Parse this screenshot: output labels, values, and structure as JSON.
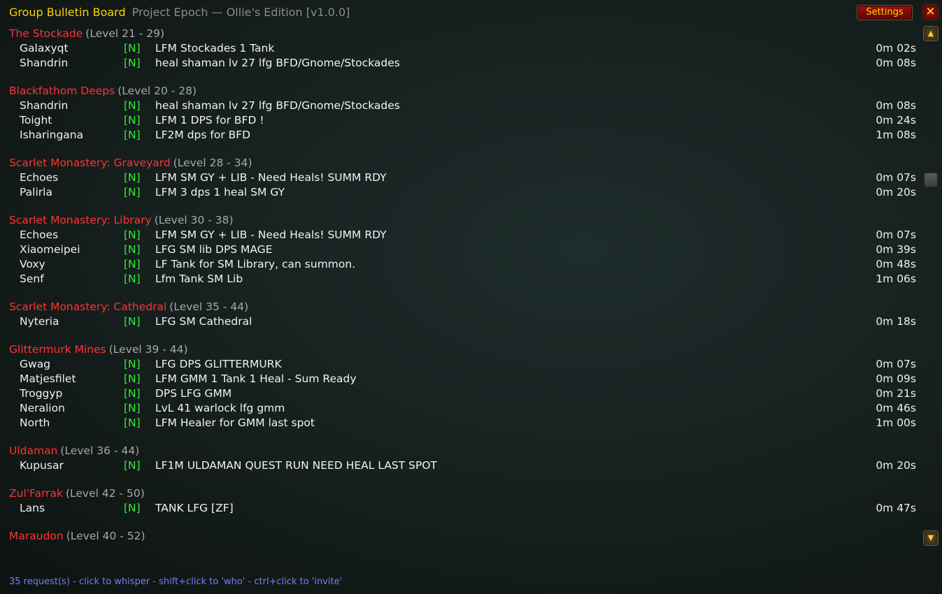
{
  "window": {
    "title": "Group Bulletin Board",
    "subtitle": "Project Epoch — Ollie's Edition [v1.0.0]",
    "settings_label": "Settings",
    "close_label": "✕"
  },
  "scroll": {
    "up_icon": "▲",
    "down_icon": "▼"
  },
  "colors": {
    "title": "#ffd100",
    "dungeon_name": "#ff3333",
    "level_range": "#a8a8a8",
    "tag": "#33ee33",
    "footer": "#6f7fff"
  },
  "categories": [
    {
      "name": "The Stockade",
      "levels": "(Level 21 - 29)",
      "entries": [
        {
          "player": "Galaxyqt",
          "tag": "[N]",
          "message": "LFM Stockades 1 Tank",
          "age": "0m 02s"
        },
        {
          "player": "Shandrin",
          "tag": "[N]",
          "message": "heal shaman lv 27 lfg BFD/Gnome/Stockades",
          "age": "0m 08s"
        }
      ]
    },
    {
      "name": "Blackfathom Deeps",
      "levels": "(Level 20 - 28)",
      "entries": [
        {
          "player": "Shandrin",
          "tag": "[N]",
          "message": "heal shaman lv 27 lfg BFD/Gnome/Stockades",
          "age": "0m 08s"
        },
        {
          "player": "Toight",
          "tag": "[N]",
          "message": "LFM 1 DPS for BFD !",
          "age": "0m 24s"
        },
        {
          "player": "Isharingana",
          "tag": "[N]",
          "message": "LF2M dps for BFD",
          "age": "1m 08s"
        }
      ]
    },
    {
      "name": "Scarlet Monastery: Graveyard",
      "levels": "(Level 28 - 34)",
      "entries": [
        {
          "player": "Echoes",
          "tag": "[N]",
          "message": "LFM SM GY + LIB - Need Heals! SUMM RDY",
          "age": "0m 07s"
        },
        {
          "player": "Palirla",
          "tag": "[N]",
          "message": "LFM 3 dps 1 heal SM GY",
          "age": "0m 20s"
        }
      ]
    },
    {
      "name": "Scarlet Monastery: Library",
      "levels": "(Level 30 - 38)",
      "entries": [
        {
          "player": "Echoes",
          "tag": "[N]",
          "message": "LFM SM GY + LIB - Need Heals! SUMM RDY",
          "age": "0m 07s"
        },
        {
          "player": "Xiaomeipei",
          "tag": "[N]",
          "message": "LFG SM lib DPS MAGE",
          "age": "0m 39s"
        },
        {
          "player": "Voxy",
          "tag": "[N]",
          "message": "LF Tank for SM Library, can summon.",
          "age": "0m 48s"
        },
        {
          "player": "Senf",
          "tag": "[N]",
          "message": "Lfm Tank SM Lib",
          "age": "1m 06s"
        }
      ]
    },
    {
      "name": "Scarlet Monastery: Cathedral",
      "levels": "(Level 35 - 44)",
      "entries": [
        {
          "player": "Nyteria",
          "tag": "[N]",
          "message": "LFG SM Cathedral",
          "age": "0m 18s"
        }
      ]
    },
    {
      "name": "Glittermurk Mines",
      "levels": "(Level 39 - 44)",
      "entries": [
        {
          "player": "Gwag",
          "tag": "[N]",
          "message": "LFG DPS GLITTERMURK",
          "age": "0m 07s"
        },
        {
          "player": "Matjesfilet",
          "tag": "[N]",
          "message": "LFM GMM 1 Tank 1 Heal - Sum Ready",
          "age": "0m 09s"
        },
        {
          "player": "Troggyp",
          "tag": "[N]",
          "message": "DPS LFG GMM",
          "age": "0m 21s"
        },
        {
          "player": "Neralion",
          "tag": "[N]",
          "message": "LvL 41 warlock lfg gmm",
          "age": "0m 46s"
        },
        {
          "player": "North",
          "tag": "[N]",
          "message": "LFM Healer for GMM last spot",
          "age": "1m 00s"
        }
      ]
    },
    {
      "name": "Uldaman",
      "levels": "(Level 36 - 44)",
      "entries": [
        {
          "player": "Kupusar",
          "tag": "[N]",
          "message": "LF1M ULDAMAN QUEST RUN NEED HEAL LAST SPOT",
          "age": "0m 20s"
        }
      ]
    },
    {
      "name": "Zul'Farrak",
      "levels": "(Level 42 - 50)",
      "entries": [
        {
          "player": "Lans",
          "tag": "[N]",
          "message": "TANK LFG [ZF]",
          "age": "0m 47s"
        }
      ]
    },
    {
      "name": "Maraudon",
      "levels": "(Level 40 - 52)",
      "entries": []
    }
  ],
  "footer": "35 request(s) - click to whisper - shift+click to 'who' - ctrl+click to 'invite'"
}
